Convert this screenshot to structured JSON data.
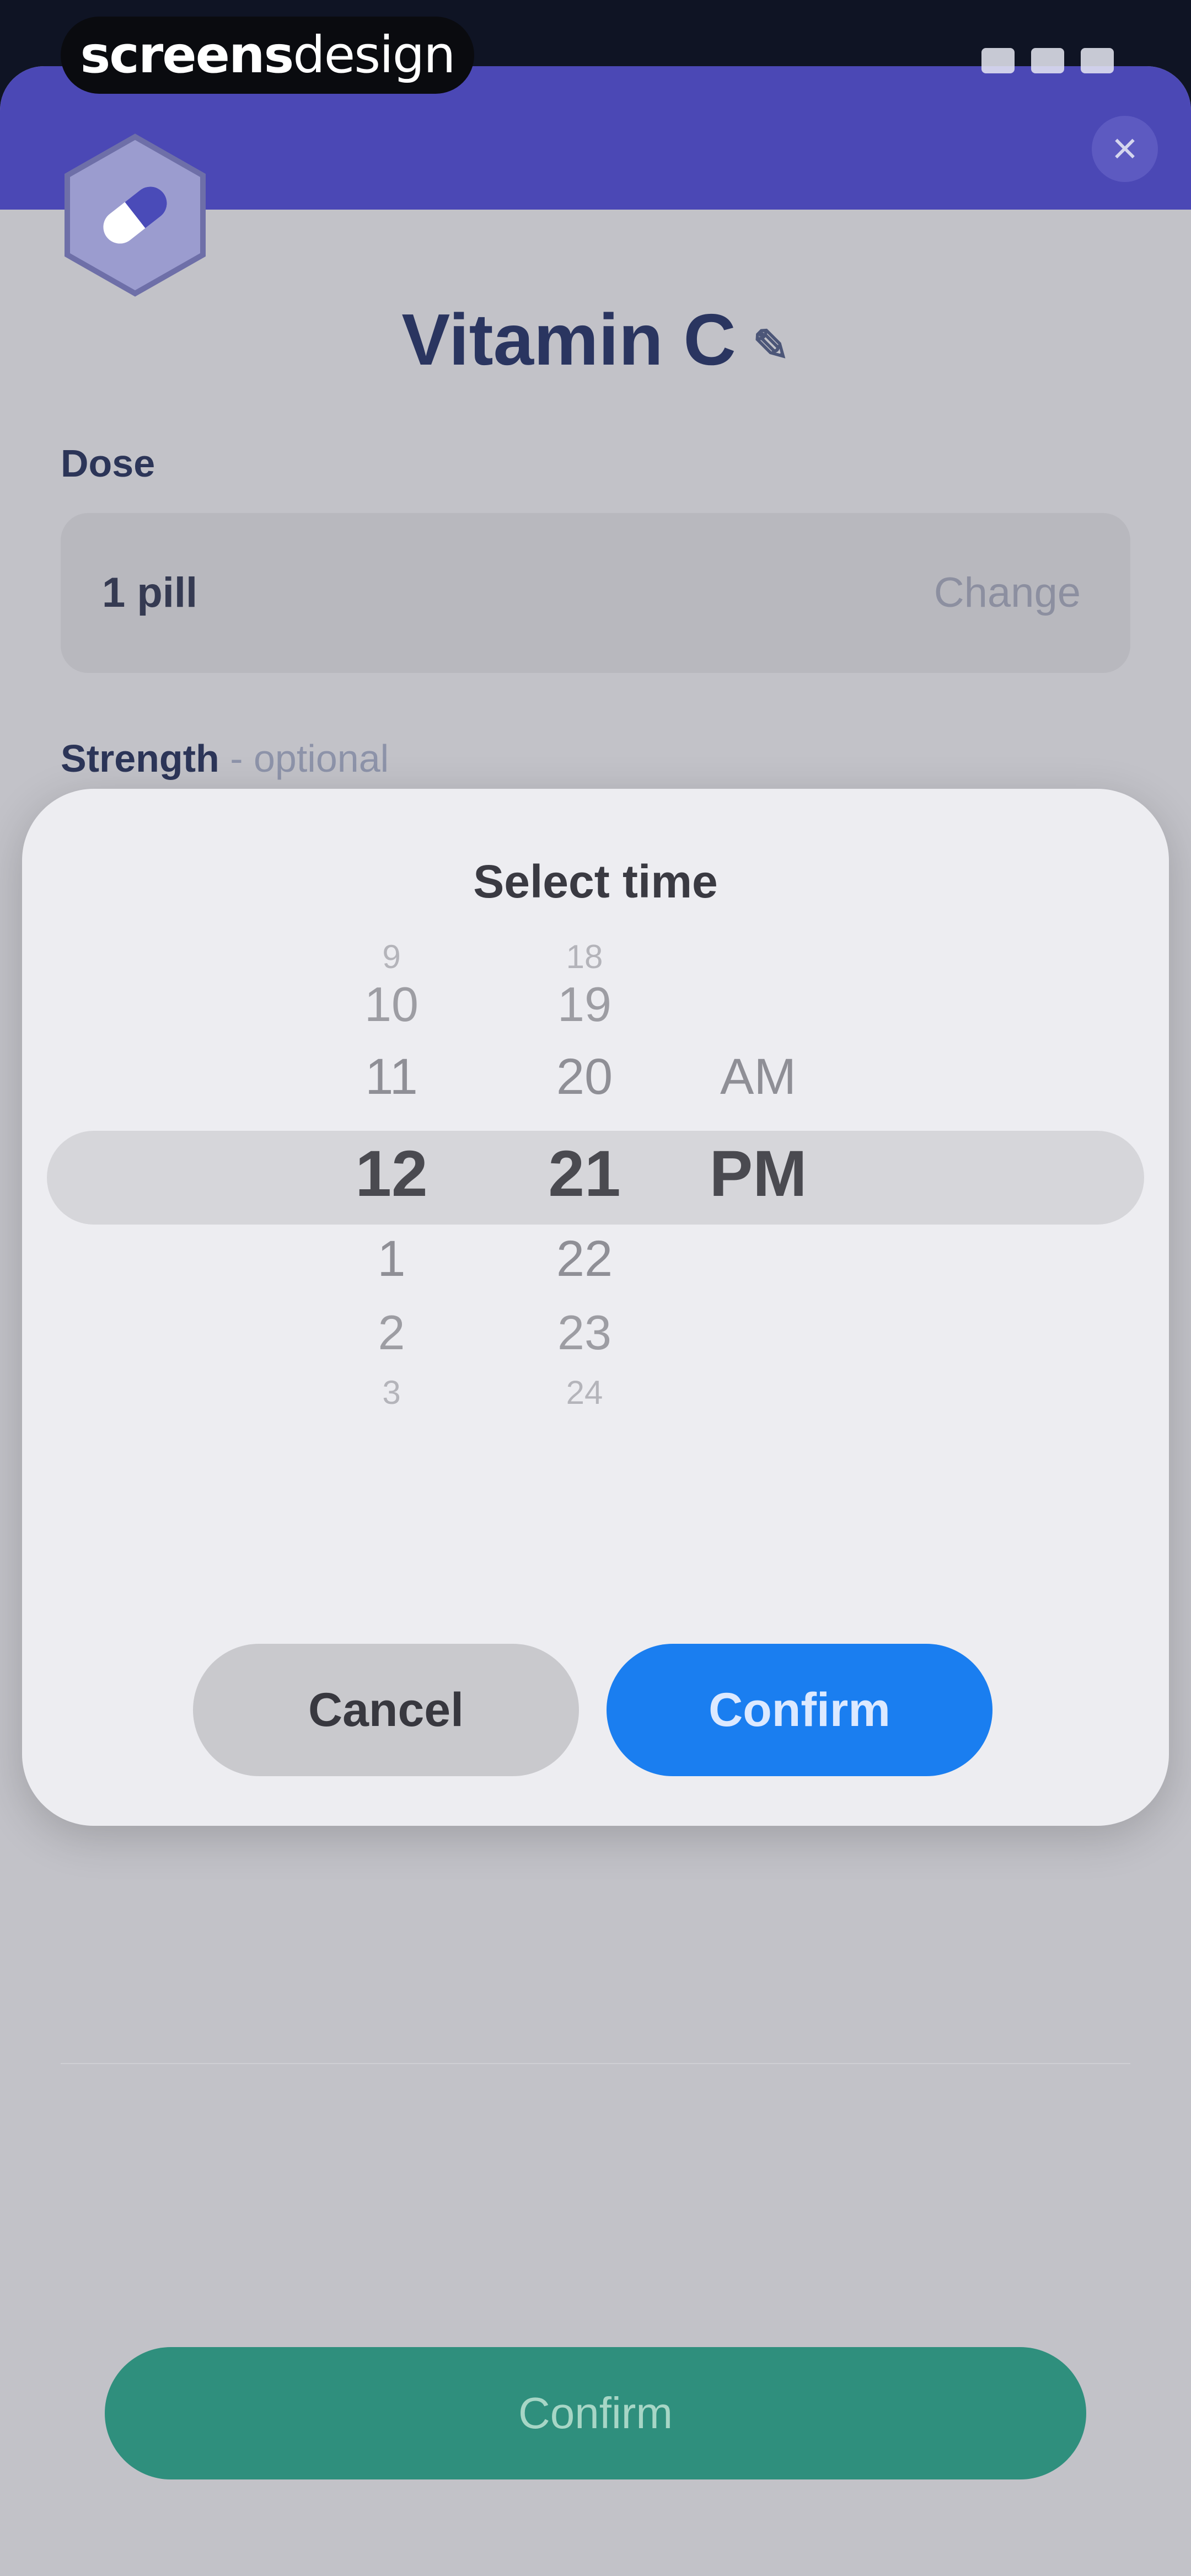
{
  "watermark": {
    "bold": "screens",
    "light": "design"
  },
  "close_icon": "×",
  "medication": {
    "name": "Vitamin C",
    "pencil_icon": "✎"
  },
  "dose": {
    "label": "Dose",
    "value": "1 pill",
    "change_label": "Change"
  },
  "strength": {
    "label": "Strength",
    "optional": " - optional"
  },
  "bottom_confirm": {
    "label": "Confirm"
  },
  "time_picker": {
    "title": "Select time",
    "hours": [
      "9",
      "10",
      "11",
      "12",
      "1",
      "2",
      "3"
    ],
    "minutes": [
      "18",
      "19",
      "20",
      "21",
      "22",
      "23",
      "24"
    ],
    "periods": [
      "AM",
      "PM"
    ],
    "selected": {
      "hour": "12",
      "minute": "21",
      "period": "PM"
    },
    "cancel_label": "Cancel",
    "confirm_label": "Confirm"
  },
  "colors": {
    "header": "#4b48b5",
    "sheet_bg": "#c2c2c8",
    "modal_bg": "#ededf1",
    "confirm_blue": "#1a7ef0",
    "confirm_green": "#2f8f7d"
  }
}
